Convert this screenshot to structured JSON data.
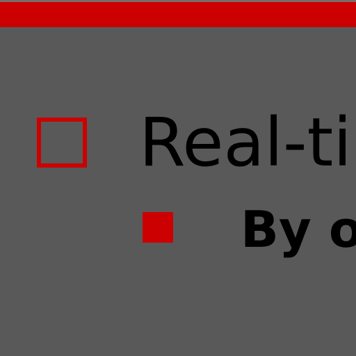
{
  "colors": {
    "background": "#595959",
    "accent": "#cc0000",
    "text": "#000000"
  },
  "slide": {
    "bullet_1": {
      "icon": "hollow-square-bullet-icon",
      "text": "Real-ti"
    },
    "bullet_2": {
      "icon": "filled-square-bullet-icon",
      "text": "By o"
    }
  }
}
